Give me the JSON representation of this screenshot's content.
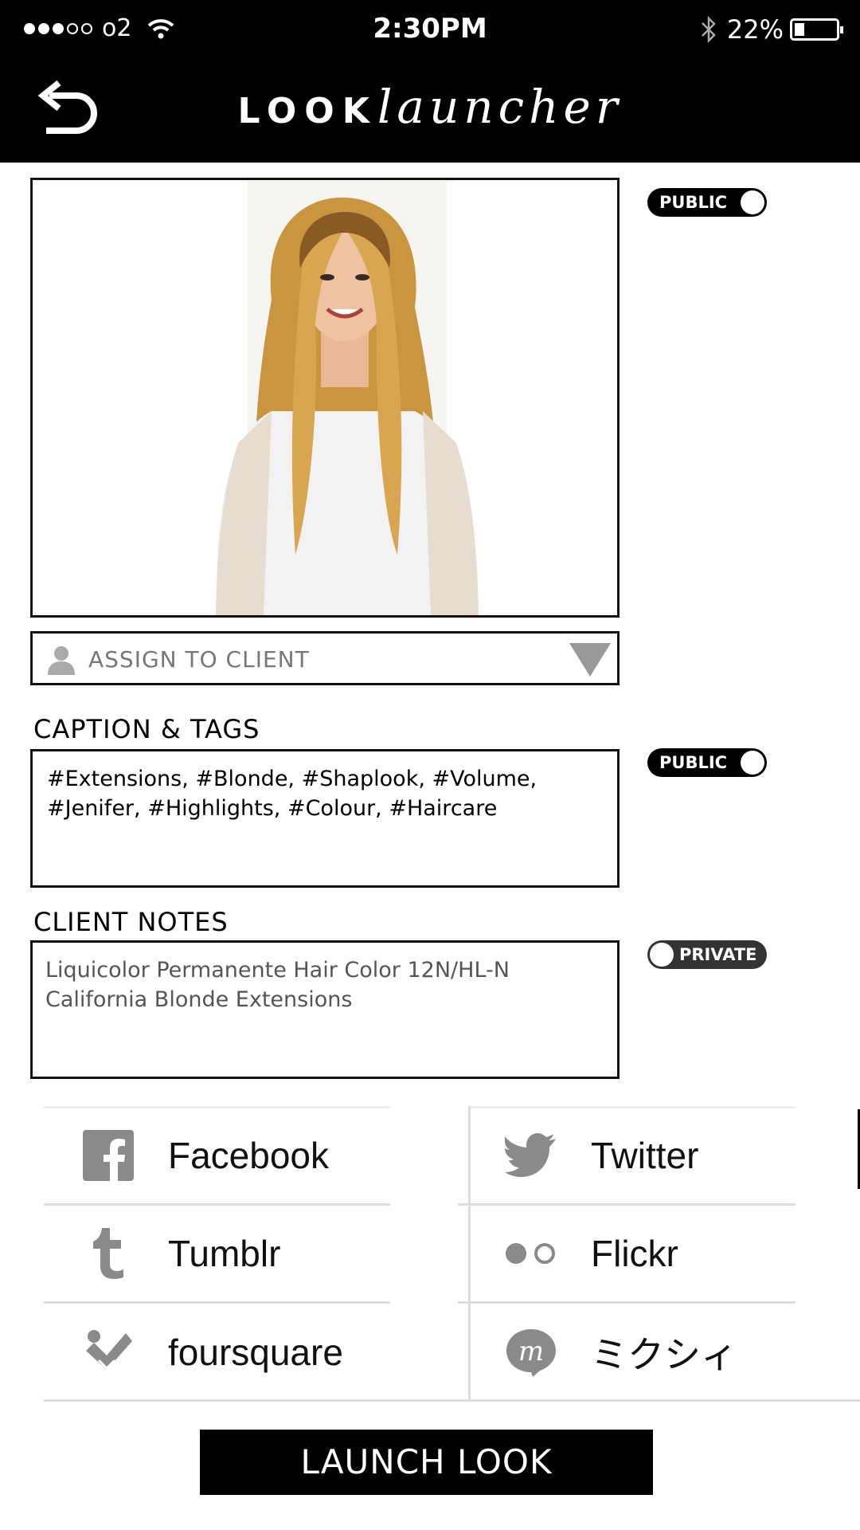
{
  "status_bar": {
    "carrier": "o2",
    "time": "2:30PM",
    "battery": "22%",
    "signal_bars": 3
  },
  "header": {
    "logo_bold": "LOOK",
    "logo_italic": "launcher"
  },
  "photo": {
    "visibility": "PUBLIC"
  },
  "assign_client": {
    "placeholder": "ASSIGN TO CLIENT"
  },
  "caption": {
    "label": "CAPTION & TAGS",
    "line1": "#Extensions, #Blonde, #Shaplook, #Volume,",
    "line2": "#Jenifer, #Highlights, #Colour, #Haircare",
    "visibility": "PUBLIC"
  },
  "notes": {
    "label": "CLIENT NOTES",
    "line1": "Liquicolor Permanente Hair Color 12N/HL-N",
    "line2": "California Blonde Extensions",
    "visibility": "PRIVATE"
  },
  "social": {
    "facebook": "Facebook",
    "twitter": "Twitter",
    "tumblr": "Tumblr",
    "flickr": "Flickr",
    "foursquare": "foursquare",
    "mixi": "ミクシィ"
  },
  "launch_button": "LAUNCH LOOK"
}
